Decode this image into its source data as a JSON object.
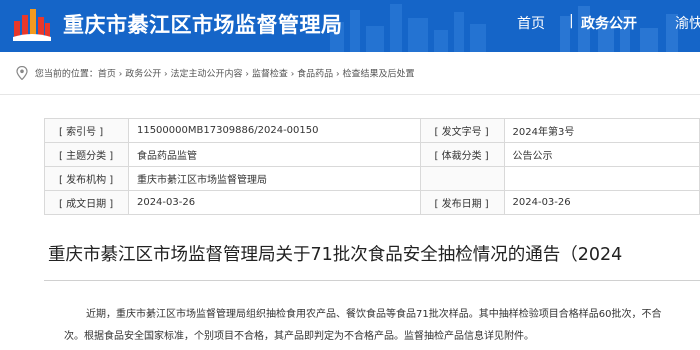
{
  "header": {
    "site_title": "重庆市綦江区市场监督管理局",
    "nav": [
      {
        "label": "首页"
      },
      {
        "label": "政务公开"
      },
      {
        "label": "渝快"
      }
    ],
    "nav_separator": "|"
  },
  "breadcrumb": {
    "text": "您当前的位置：首页 › 政务公开 › 法定主动公开内容 › 监督检查 › 食品药品 › 检查结果及后处置"
  },
  "info": {
    "rows": [
      {
        "label1": "[ 索引号 ]",
        "value1": "11500000MB17309886/2024-00150",
        "label2": "[ 发文字号 ]",
        "value2": "2024年第3号"
      },
      {
        "label1": "[ 主题分类 ]",
        "value1": "食品药品监管",
        "label2": "[ 体裁分类 ]",
        "value2": "公告公示"
      },
      {
        "label1": "[ 发布机构 ]",
        "value1": "重庆市綦江区市场监督管理局",
        "label2": "",
        "value2": ""
      },
      {
        "label1": "[ 成文日期 ]",
        "value1": "2024-03-26",
        "label2": "[ 发布日期 ]",
        "value2": "2024-03-26"
      }
    ]
  },
  "article": {
    "title": "重庆市綦江区市场监督管理局关于71批次食品安全抽检情况的通告（2024",
    "paragraph_line1": "近期，重庆市綦江区市场监督管理局组织抽检食用农产品、餐饮食品等食品71批次样品。其中抽样检验项目合格样品60批次，不合",
    "paragraph_line2": "次。根据食品安全国家标准，个别项目不合格，其产品即判定为不合格产品。监督抽检产品信息详见附件。"
  },
  "colors": {
    "header_bg": "#1565c8",
    "logo_red": "#e8382b",
    "logo_orange": "#f39a1e"
  }
}
